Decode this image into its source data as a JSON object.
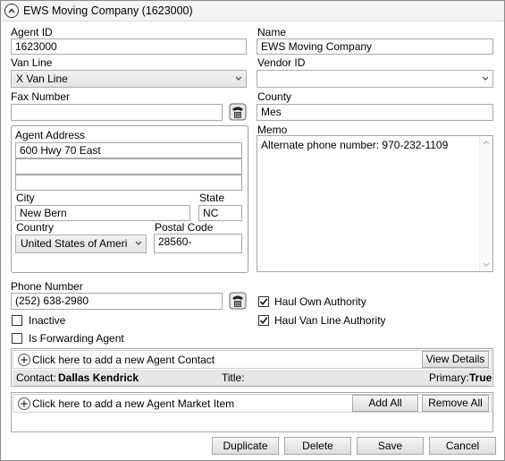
{
  "window": {
    "title": "EWS Moving Company (1623000)"
  },
  "form": {
    "agent_id_label": "Agent ID",
    "agent_id_value": "1623000",
    "name_label": "Name",
    "name_value": "EWS Moving Company",
    "van_line_label": "Van Line",
    "van_line_value": "X Van Line",
    "vendor_id_label": "Vendor ID",
    "vendor_id_value": "",
    "fax_label": "Fax Number",
    "fax_value": "",
    "county_label": "County",
    "county_value": "Mes",
    "memo_label": "Memo",
    "memo_value": "Alternate phone number: 970-232-1109",
    "phone_label": "Phone Number",
    "phone_value": "(252) 638-2980"
  },
  "address": {
    "header": "Agent Address",
    "line1": "600 Hwy 70 East",
    "line2": "",
    "line3": "",
    "city_label": "City",
    "city_value": "New Bern",
    "state_label": "State",
    "state_value": "NC",
    "country_label": "Country",
    "country_value": "United States of Ameri",
    "postal_label": "Postal Code",
    "postal_value": "28560-"
  },
  "checkboxes": {
    "inactive": {
      "label": "Inactive",
      "checked": false
    },
    "forwarding": {
      "label": "Is Forwarding Agent",
      "checked": false
    },
    "haul_own": {
      "label": "Haul Own Authority",
      "checked": true
    },
    "haul_van_line": {
      "label": "Haul Van Line Authority",
      "checked": true
    }
  },
  "contacts": {
    "add_text": "Click here to add a new Agent Contact",
    "view_details_label": "View Details",
    "contact_label": "Contact:",
    "contact_value": "Dallas Kendrick",
    "title_label": "Title:",
    "title_value": "",
    "primary_label": "Primary:",
    "primary_value": "True"
  },
  "market": {
    "add_text": "Click here to add a new Agent Market Item",
    "add_all_label": "Add All",
    "remove_all_label": "Remove All"
  },
  "actions": {
    "duplicate_label": "Duplicate",
    "delete_label": "Delete",
    "save_label": "Save",
    "cancel_label": "Cancel"
  },
  "icons": {
    "collapse": "chevron-up-icon",
    "phone": "phone-icon",
    "add": "plus-icon",
    "dropdown": "chevron-down-icon",
    "check": "check-icon"
  }
}
